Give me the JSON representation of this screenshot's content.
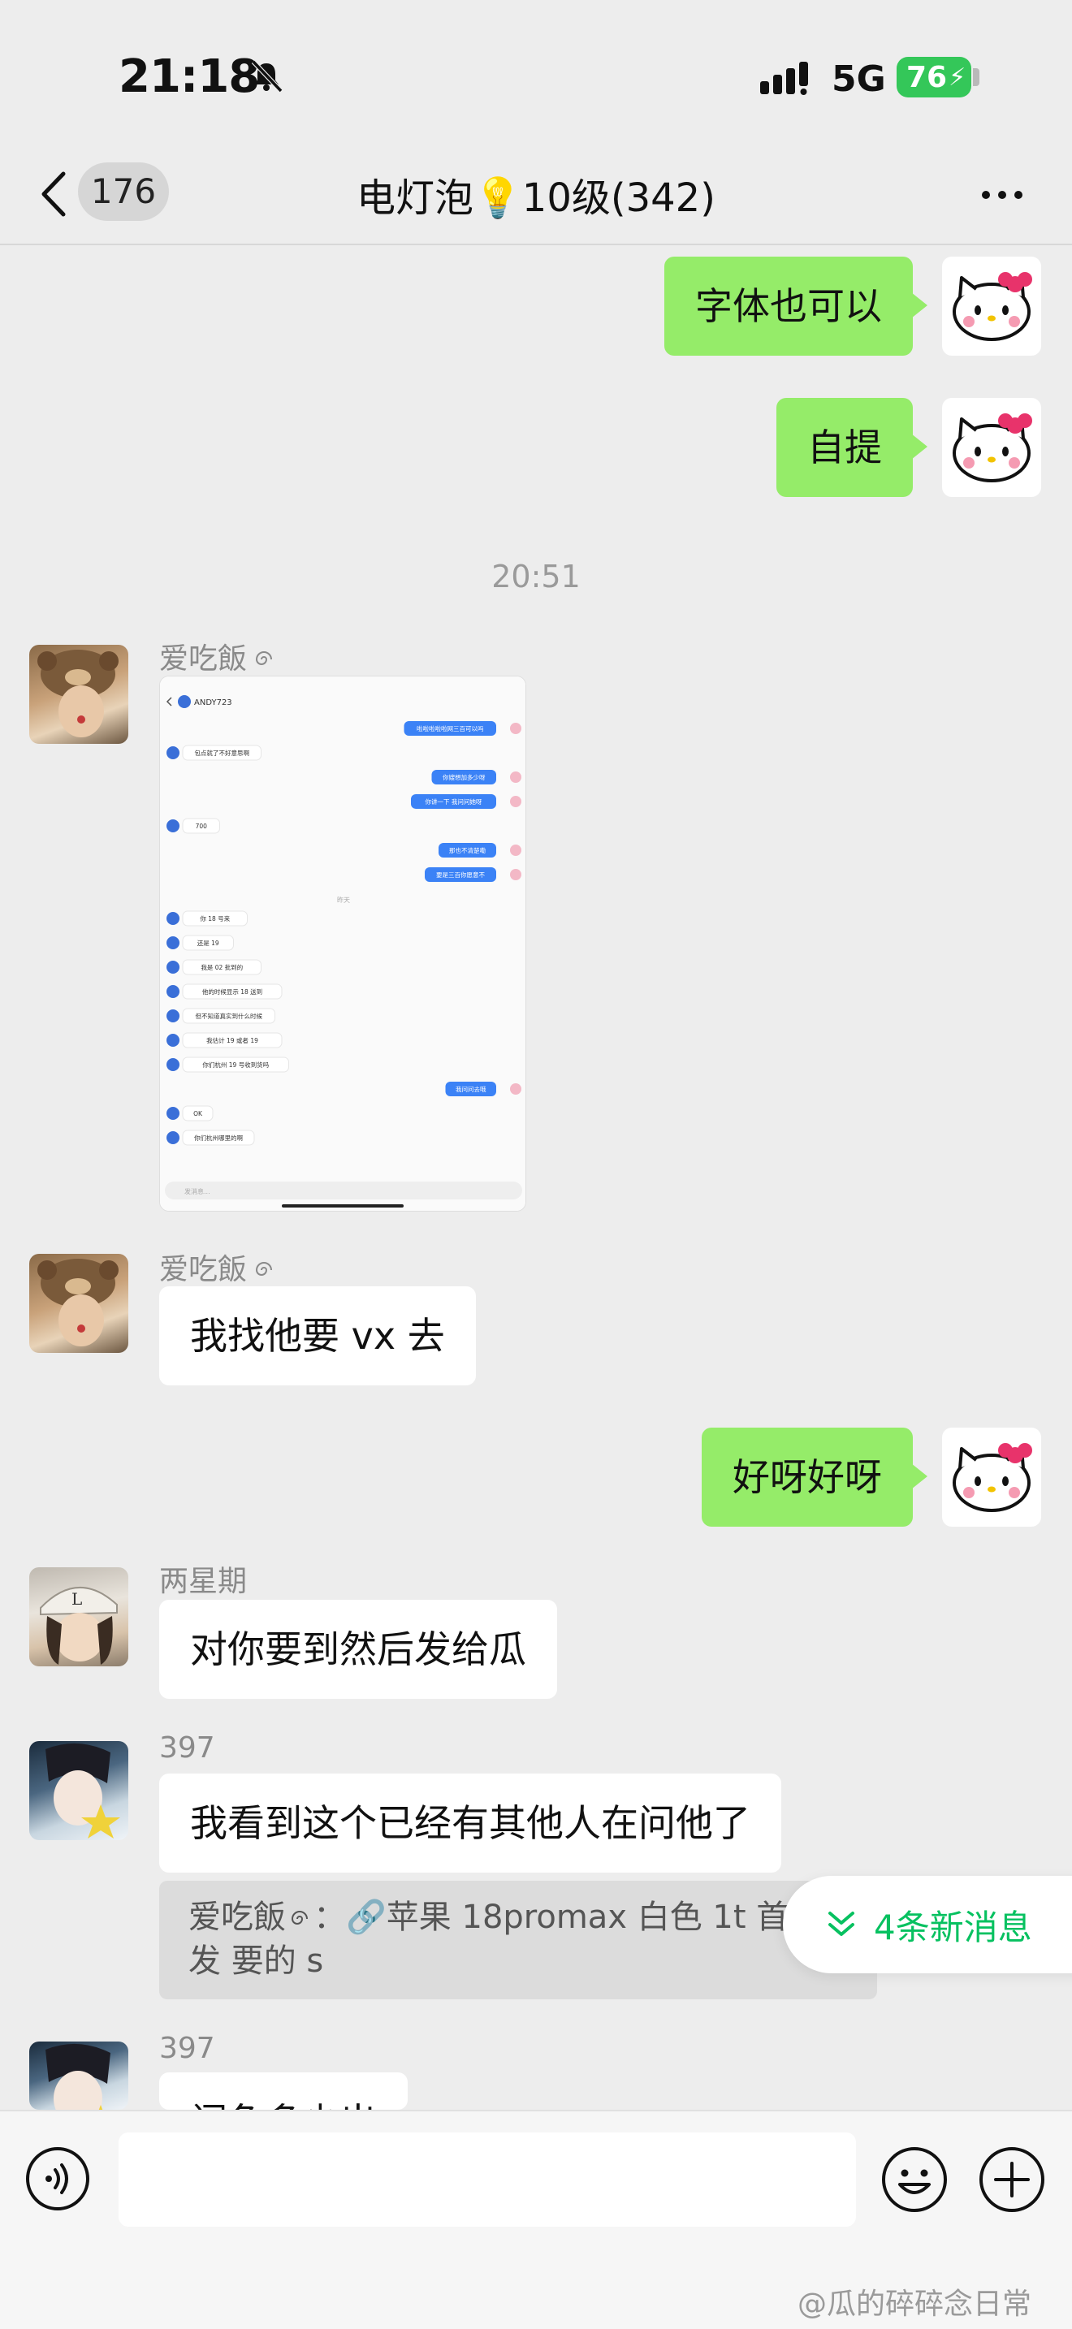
{
  "status_bar": {
    "time": "21:18",
    "network": "5G",
    "battery": "76"
  },
  "nav": {
    "back_count": "176",
    "title": "电灯泡💡10级(342)"
  },
  "messages": {
    "m1": {
      "text": "字体也可以"
    },
    "m2": {
      "text": "自提"
    },
    "timestamp": "20:51",
    "m3": {
      "sender": "爱吃飯",
      "type": "image"
    },
    "m4": {
      "sender": "爱吃飯",
      "text": "我找他要 vx 去"
    },
    "m5": {
      "text": "好呀好呀"
    },
    "m6": {
      "sender": "两星期",
      "text": "对你要到然后发给瓜"
    },
    "m7": {
      "sender": "397",
      "text": "我看到这个已经有其他人在问他了"
    },
    "quote": {
      "line1": "爱吃飯",
      "line1b": "：🔗苹果 18promax 白色 1t 首",
      "line2": "发 要的 s"
    },
    "m8": {
      "sender": "397",
      "text": "闲鱼多少出"
    }
  },
  "new_messages": {
    "label": "4条新消息"
  },
  "screenshot_preview": {
    "header_name": "ANDY723",
    "rows": [
      {
        "side": "right",
        "text": "啦啦啦啦啦网三百可以吗"
      },
      {
        "side": "left",
        "text": "包点就了不好意思啊"
      },
      {
        "side": "right",
        "text": "你嫂想加多少呀"
      },
      {
        "side": "right",
        "text": "你讲一下 我问问她呀"
      },
      {
        "side": "left",
        "text": "700"
      },
      {
        "side": "right",
        "text": "那也不清楚嘞"
      },
      {
        "side": "right",
        "text": "要是三百你愿意不"
      },
      {
        "side": "center",
        "text": "昨天"
      },
      {
        "side": "left",
        "text": "你 18 号来"
      },
      {
        "side": "left",
        "text": "还是 19"
      },
      {
        "side": "left",
        "text": "我是 02 批到的"
      },
      {
        "side": "left",
        "text": "他的时候显示 18 送到"
      },
      {
        "side": "left",
        "text": "但不知道真实到什么时候"
      },
      {
        "side": "left",
        "text": "我估计 19 或者 19"
      },
      {
        "side": "left",
        "text": "你们杭州 19 号收到货吗"
      },
      {
        "side": "right",
        "text": "我问问去哦"
      },
      {
        "side": "left",
        "text": "OK"
      },
      {
        "side": "left",
        "text": "你们杭州哪里的啊"
      }
    ],
    "input_placeholder": "发消息..."
  },
  "watermark": "@瓜的碎碎念日常",
  "colors": {
    "outgoing_bubble": "#95ec69",
    "accent": "#07c160",
    "background": "#ededed"
  }
}
